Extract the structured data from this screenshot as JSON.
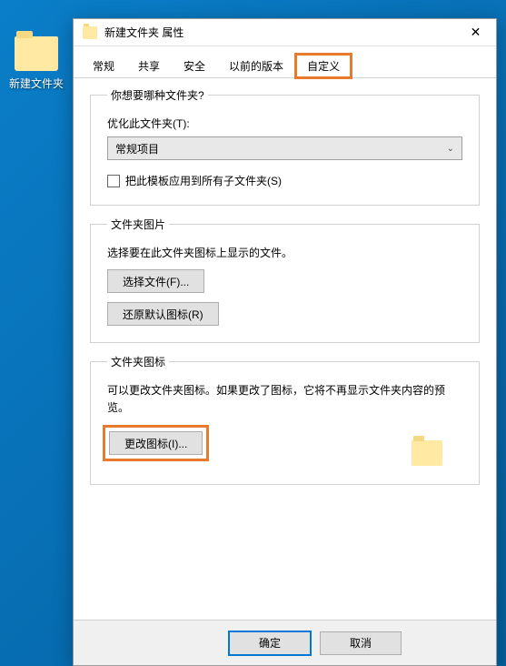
{
  "desktop": {
    "folder_label": "新建文件夹"
  },
  "dialog": {
    "title": "新建文件夹 属性",
    "close": "✕",
    "tabs": [
      {
        "label": "常规"
      },
      {
        "label": "共享"
      },
      {
        "label": "安全"
      },
      {
        "label": "以前的版本"
      },
      {
        "label": "自定义"
      }
    ],
    "folder_type": {
      "legend": "你想要哪种文件夹?",
      "optimize_label": "优化此文件夹(T):",
      "selected": "常规项目",
      "checkbox_label": "把此模板应用到所有子文件夹(S)"
    },
    "folder_picture": {
      "legend": "文件夹图片",
      "desc": "选择要在此文件夹图标上显示的文件。",
      "choose_btn": "选择文件(F)...",
      "restore_btn": "还原默认图标(R)"
    },
    "folder_icon": {
      "legend": "文件夹图标",
      "desc": "可以更改文件夹图标。如果更改了图标，它将不再显示文件夹内容的预览。",
      "change_btn": "更改图标(I)..."
    },
    "footer": {
      "ok": "确定",
      "cancel": "取消"
    }
  }
}
